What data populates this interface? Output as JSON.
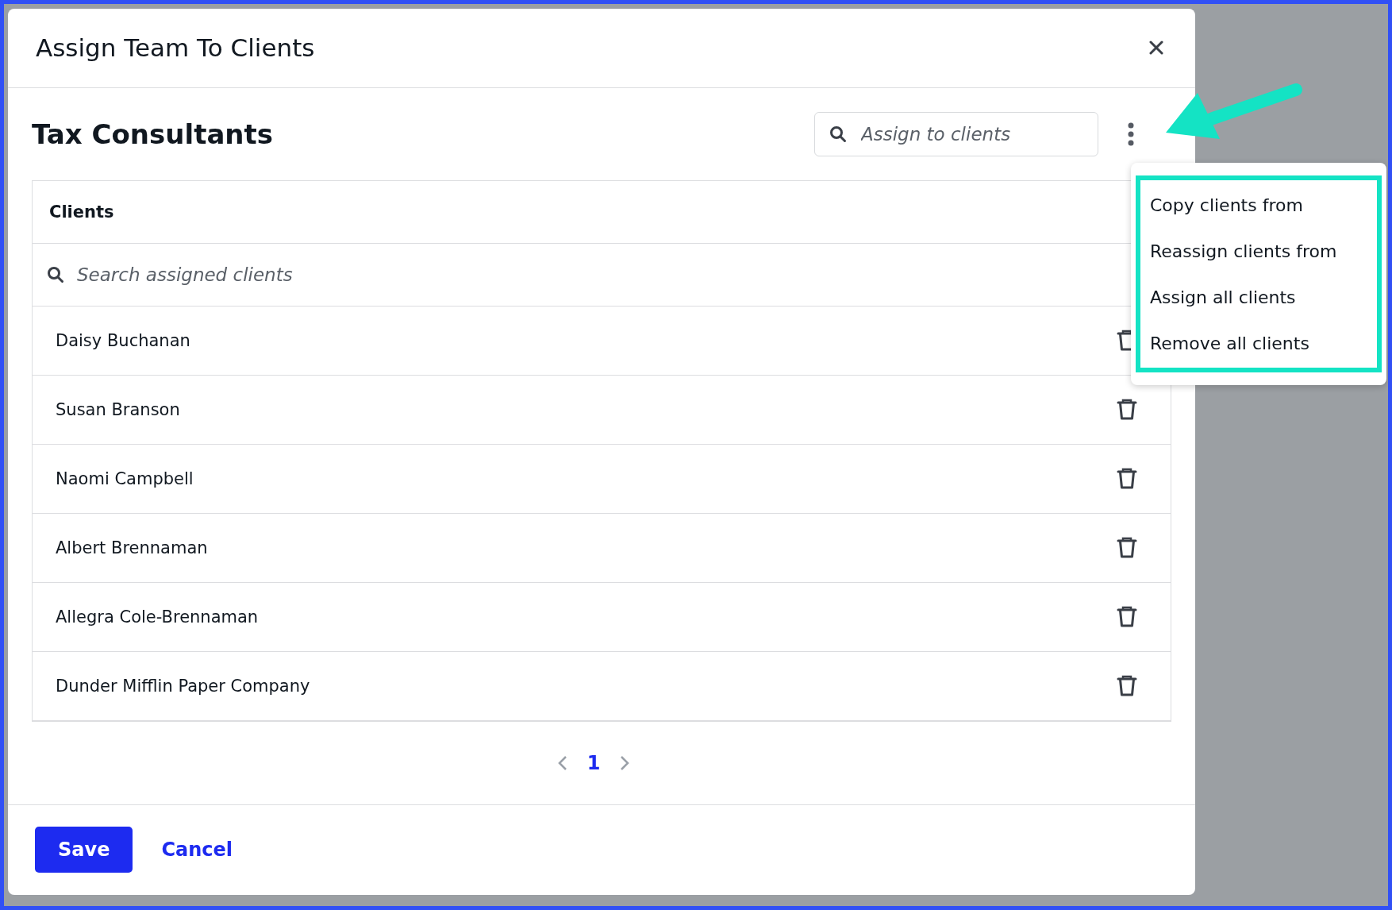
{
  "dialog": {
    "title": "Assign Team To Clients"
  },
  "team": {
    "name": "Tax Consultants"
  },
  "assign_search": {
    "placeholder": "Assign to clients"
  },
  "more_menu": {
    "open": true,
    "items": [
      {
        "label": "Copy clients from"
      },
      {
        "label": "Reassign clients from"
      },
      {
        "label": "Assign all clients"
      },
      {
        "label": "Remove all clients"
      }
    ]
  },
  "table": {
    "columns": [
      "Clients"
    ],
    "search": {
      "placeholder": "Search assigned clients"
    },
    "rows": [
      {
        "name": "Daisy Buchanan"
      },
      {
        "name": "Susan Branson"
      },
      {
        "name": "Naomi Campbell"
      },
      {
        "name": "Albert Brennaman"
      },
      {
        "name": "Allegra Cole-Brennaman"
      },
      {
        "name": "Dunder Mifflin Paper Company"
      }
    ]
  },
  "pagination": {
    "pages": [
      {
        "label": "1",
        "selected": true
      }
    ]
  },
  "buttons": [
    {
      "kind": "primary",
      "label": "Save"
    },
    {
      "kind": "link",
      "label": "Cancel"
    }
  ]
}
